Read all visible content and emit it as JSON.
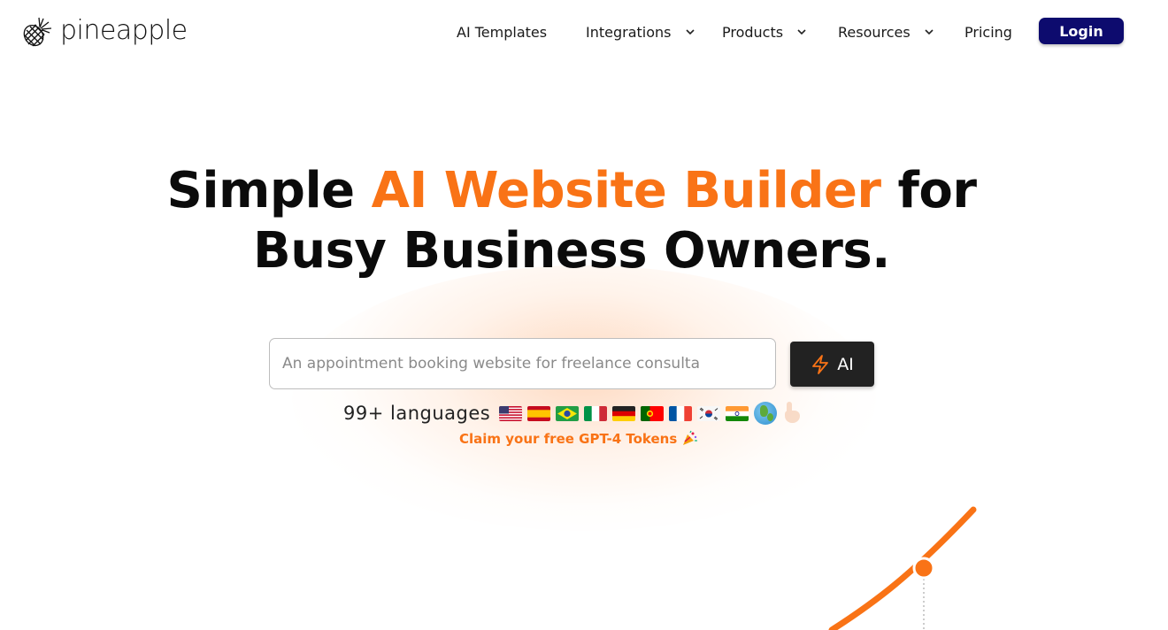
{
  "brand": {
    "name": "pineapple",
    "logo_icon": "pineapple-icon"
  },
  "nav": {
    "items": [
      {
        "label": "AI Templates",
        "has_dropdown": false
      },
      {
        "label": "Integrations",
        "has_dropdown": true
      },
      {
        "label": "Products",
        "has_dropdown": true
      },
      {
        "label": "Resources",
        "has_dropdown": true
      },
      {
        "label": "Pricing",
        "has_dropdown": false
      }
    ],
    "login_label": "Login"
  },
  "hero": {
    "headline_part1": "Simple ",
    "headline_accent": "AI Website Builder",
    "headline_part2": " for",
    "headline_line2": "Busy Business Owners.",
    "input_placeholder": "An appointment booking website for freelance consulta",
    "ai_button_label": "AI",
    "languages_label": "99+ languages",
    "flags": [
      "us",
      "es",
      "br",
      "it",
      "de",
      "pt",
      "fr",
      "kr",
      "in"
    ],
    "claim_text": "Claim your free GPT-4 Tokens"
  },
  "colors": {
    "accent": "#f97316",
    "login_bg": "#0d0b6e",
    "ai_button_bg": "#222222",
    "text": "#0b0b0b"
  }
}
